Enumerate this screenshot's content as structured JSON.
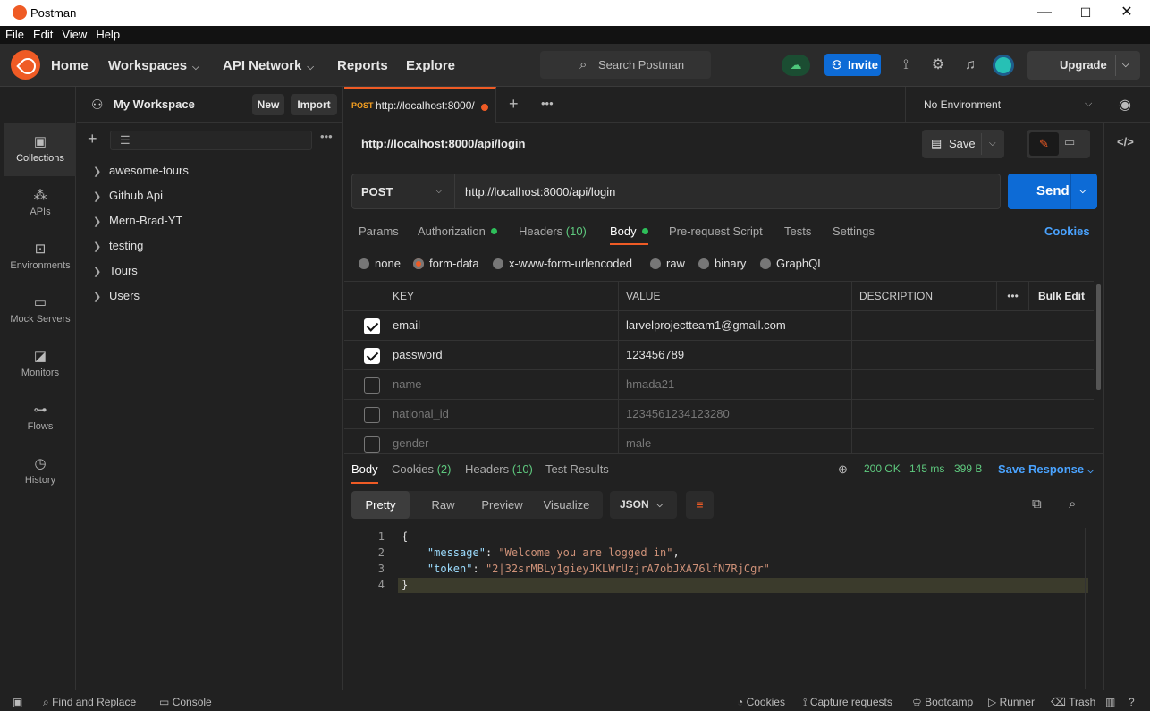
{
  "window": {
    "title": "Postman",
    "minimize": "—",
    "maximize": "☐",
    "close": "✕"
  },
  "menu": [
    "File",
    "Edit",
    "View",
    "Help"
  ],
  "header": {
    "nav": [
      "Home",
      "Workspaces",
      "API Network",
      "Reports",
      "Explore"
    ],
    "search_placeholder": "Search Postman",
    "invite": "Invite",
    "upgrade": "Upgrade"
  },
  "rail": [
    {
      "label": "Collections",
      "icon": "collections-icon"
    },
    {
      "label": "APIs",
      "icon": "apis-icon"
    },
    {
      "label": "Environments",
      "icon": "environments-icon"
    },
    {
      "label": "Mock Servers",
      "icon": "mock-servers-icon"
    },
    {
      "label": "Monitors",
      "icon": "monitors-icon"
    },
    {
      "label": "Flows",
      "icon": "flows-icon"
    },
    {
      "label": "History",
      "icon": "history-icon"
    }
  ],
  "workspace": {
    "name": "My Workspace",
    "new": "New",
    "import": "Import"
  },
  "collections": [
    "awesome-tours",
    "Github Api",
    "Mern-Brad-YT",
    "testing",
    "Tours",
    "Users"
  ],
  "tab": {
    "method": "POST",
    "url": "http://localhost:8000/"
  },
  "environment": "No Environment",
  "request": {
    "title": "http://localhost:8000/api/login",
    "save": "Save",
    "method": "POST",
    "url": "http://localhost:8000/api/login",
    "send": "Send",
    "tabs": {
      "params": "Params",
      "auth": "Authorization",
      "headers": "Headers",
      "headers_count": "(10)",
      "body": "Body",
      "prereq": "Pre-request Script",
      "tests": "Tests",
      "settings": "Settings"
    },
    "cookies": "Cookies",
    "body_types": [
      "none",
      "form-data",
      "x-www-form-urlencoded",
      "raw",
      "binary",
      "GraphQL"
    ],
    "selected_body_type": "form-data"
  },
  "params_table": {
    "headers": {
      "key": "KEY",
      "value": "VALUE",
      "description": "DESCRIPTION",
      "bulk": "Bulk Edit"
    },
    "rows": [
      {
        "checked": true,
        "key": "email",
        "value": "larvelprojectteam1@gmail.com",
        "description": ""
      },
      {
        "checked": true,
        "key": "password",
        "value": "123456789",
        "description": ""
      },
      {
        "checked": false,
        "key": "name",
        "value": "hmada21",
        "description": ""
      },
      {
        "checked": false,
        "key": "national_id",
        "value": "1234561234123280",
        "description": ""
      },
      {
        "checked": false,
        "key": "gender",
        "value": "male",
        "description": ""
      }
    ]
  },
  "response": {
    "tabs": {
      "body": "Body",
      "cookies": "Cookies",
      "cookies_count": "(2)",
      "headers": "Headers",
      "headers_count": "(10)",
      "test_results": "Test Results"
    },
    "status": "200 OK",
    "time": "145 ms",
    "size": "399 B",
    "save": "Save Response",
    "formats": [
      "Pretty",
      "Raw",
      "Preview",
      "Visualize"
    ],
    "language": "JSON",
    "code": {
      "line_numbers": [
        "1",
        "2",
        "3",
        "4"
      ],
      "open": "{",
      "close": "}",
      "message_key": "\"message\"",
      "message_value": "\"Welcome you are logged in\"",
      "token_key": "\"token\"",
      "token_value": "\"2|32srMBLy1gieyJKLWrUzjrA7obJXA76lfN7RjCgr\""
    }
  },
  "statusbar": {
    "find": "Find and Replace",
    "console": "Console",
    "cookies": "Cookies",
    "capture": "Capture requests",
    "bootcamp": "Bootcamp",
    "runner": "Runner",
    "trash": "Trash"
  }
}
